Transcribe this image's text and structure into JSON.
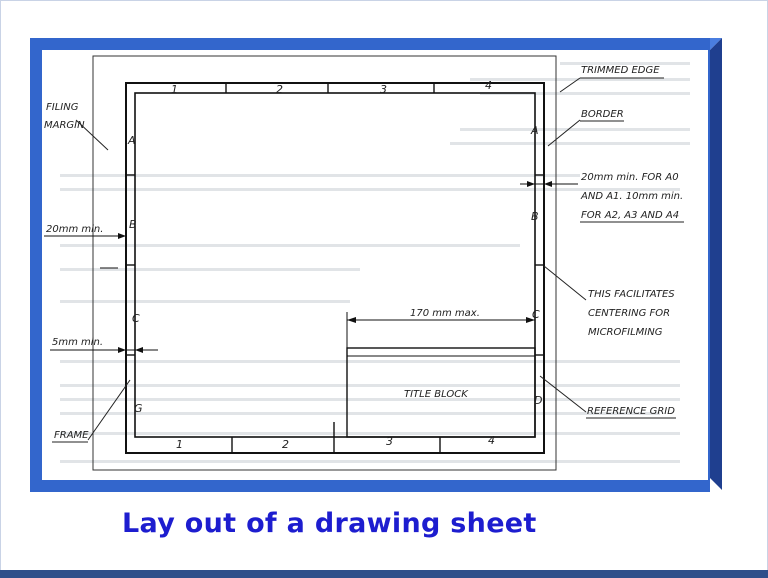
{
  "caption": "Lay out of a drawing sheet",
  "labels": {
    "trimmed_edge": "TRIMMED EDGE",
    "border": "BORDER",
    "filing_margin_1": "FILING",
    "filing_margin_2": "MARGIN",
    "min_20mm": "20mm min.",
    "min_5mm": "5mm min.",
    "frame": "FRAME",
    "note_1": "20mm min. FOR A0",
    "note_2": "AND A1. 10mm min.",
    "note_3": "FOR A2, A3 AND A4",
    "centering_1": "THIS FACILITATES",
    "centering_2": "CENTERING FOR",
    "centering_3": "MICROFILMING",
    "max_170": "170 mm max.",
    "title_block": "TITLE BLOCK",
    "reference_grid": "REFERENCE GRID"
  },
  "grid": {
    "top_numbers": [
      "1",
      "2",
      "3",
      "4"
    ],
    "bottom_numbers": [
      "1",
      "2",
      "3",
      "4"
    ],
    "left_letters": [
      "A",
      "B",
      "C",
      "G"
    ],
    "right_letters": [
      "A",
      "B",
      "C",
      "D"
    ]
  },
  "colors": {
    "panel": "#3366cc",
    "panel_dark": "#1f3f8f",
    "caption": "#1d1dcf"
  }
}
